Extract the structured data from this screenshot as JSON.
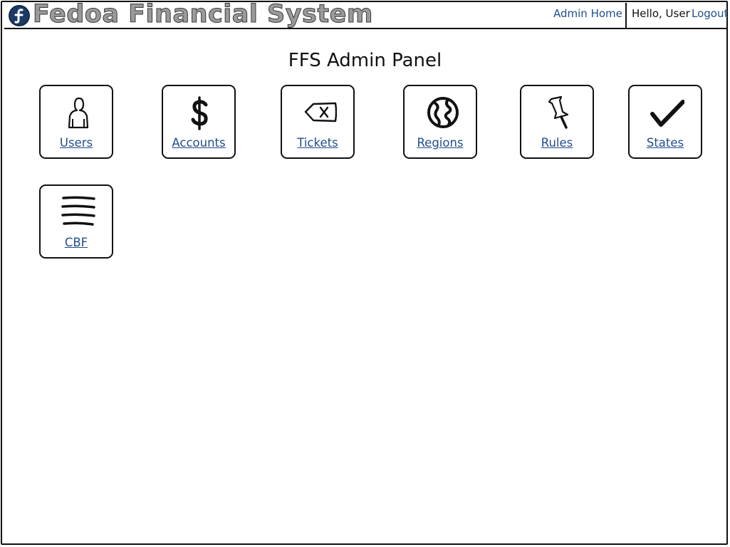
{
  "header": {
    "app_title": "Fedoa Financial System",
    "admin_home": "Admin Home",
    "greeting": "Hello, User",
    "logout": "Logout"
  },
  "main": {
    "title": "FFS Admin Panel",
    "tiles": [
      {
        "label": "Users",
        "icon": "user-icon"
      },
      {
        "label": "Accounts",
        "icon": "dollar-icon"
      },
      {
        "label": "Tickets",
        "icon": "clear-ticket-icon"
      },
      {
        "label": "Regions",
        "icon": "globe-icon"
      },
      {
        "label": "Rules",
        "icon": "pushpin-icon"
      },
      {
        "label": "States ",
        "icon": "checkmark-icon"
      },
      {
        "label": "CBF",
        "icon": "list-lines-icon"
      }
    ]
  },
  "colors": {
    "link": "#1f4d8c",
    "border": "#111111",
    "logo": "#1b3a66"
  }
}
